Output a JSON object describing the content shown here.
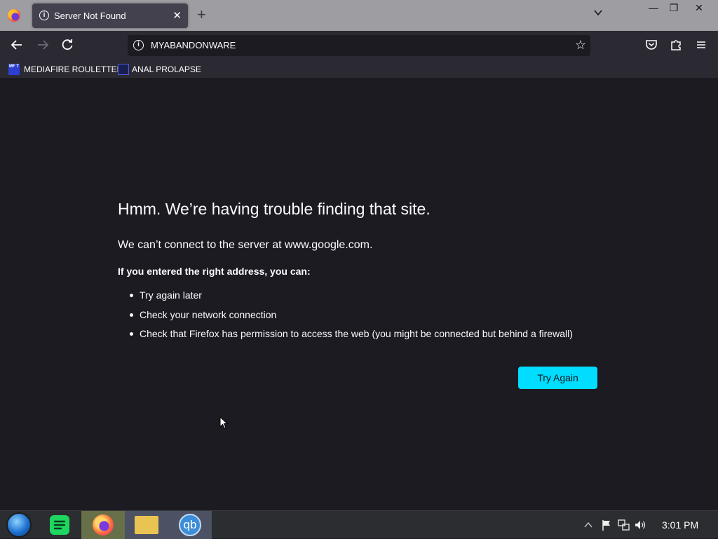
{
  "tab": {
    "title": "Server Not Found",
    "close_glyph": "✕"
  },
  "newtab": {
    "glyph": "+"
  },
  "window_controls": {
    "minimize": "—",
    "restore": "❐",
    "close": "✕"
  },
  "urlbar": {
    "value": "MYABANDONWARE"
  },
  "bookmarks": [
    {
      "label": "MEDIAFIRE ROULETTER",
      "icon_text": "MF T"
    },
    {
      "label": "ANAL PROLAPSE"
    }
  ],
  "error": {
    "title": "Hmm. We’re having trouble finding that site.",
    "short_desc": "We can’t connect to the server at www.google.com.",
    "sub_heading": "If you entered the right address, you can:",
    "suggestions": [
      "Try again later",
      "Check your network connection",
      "Check that Firefox has permission to access the web (you might be connected but behind a firewall)"
    ],
    "button_label": "Try Again"
  },
  "taskbar": {
    "qbit_label": "qb",
    "clock": "3:01 PM"
  },
  "colors": {
    "accent": "#00ddff",
    "page_bg": "#1c1b22",
    "toolbar_bg": "#2b2a33",
    "tab_bg": "#42414d",
    "titlebar_bg": "#9d9da2"
  }
}
